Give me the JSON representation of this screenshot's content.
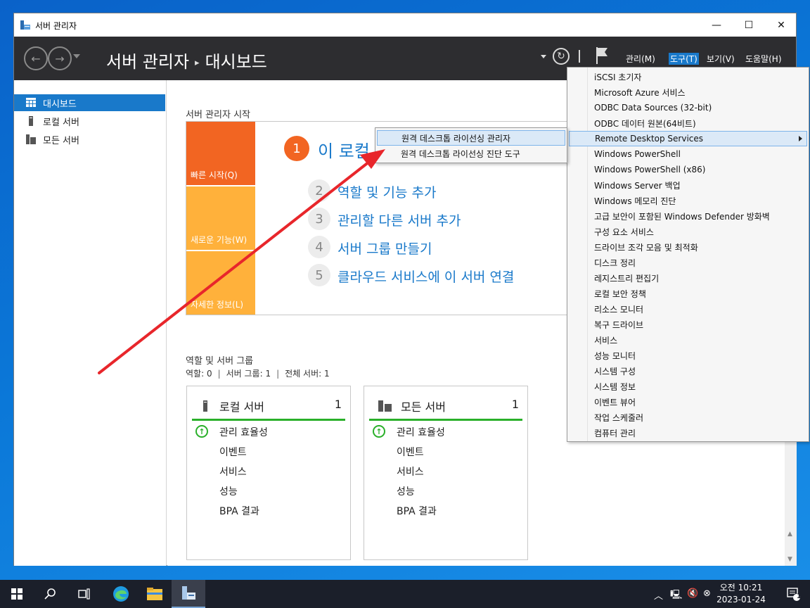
{
  "window": {
    "title": "서버 관리자",
    "minimize": "—",
    "maximize": "☐",
    "close": "✕"
  },
  "header": {
    "app_name": "서버 관리자",
    "separator": "▸",
    "page": "대시보드",
    "menus": [
      "관리(M)",
      "도구(T)",
      "보기(V)",
      "도움말(H)"
    ],
    "active_menu_index": 1
  },
  "sidebar": {
    "items": [
      {
        "label": "대시보드",
        "icon": "dashboard-icon",
        "selected": true
      },
      {
        "label": "로컬 서버",
        "icon": "server-icon",
        "selected": false
      },
      {
        "label": "모든 서버",
        "icon": "servers-icon",
        "selected": false
      }
    ]
  },
  "welcome": {
    "section_title": "서버 관리자 시작",
    "tiles": [
      "빠른 시작(Q)",
      "새로운 기능(W)",
      "자세한 정보(L)"
    ],
    "tile_colors": [
      "#f26522",
      "#ffb13b",
      "#ffb13b"
    ],
    "step1_number": "1",
    "step1_text": "이 로컬",
    "steps": [
      {
        "num": "2",
        "text": "역할 및 기능 추가"
      },
      {
        "num": "3",
        "text": "관리할 다른 서버 추가"
      },
      {
        "num": "4",
        "text": "서버 그룹 만들기"
      },
      {
        "num": "5",
        "text": "클라우드 서비스에 이 서버 연결"
      }
    ]
  },
  "roles": {
    "section_title": "역할 및 서버 그룹",
    "counts": [
      "역할: 0",
      "서버 그룹: 1",
      "전체 서버: 1"
    ],
    "separator": "|",
    "cards": [
      {
        "title": "로컬 서버",
        "count": "1",
        "rows": [
          "관리 효율성",
          "이벤트",
          "서비스",
          "성능",
          "BPA 결과"
        ]
      },
      {
        "title": "모든 서버",
        "count": "1",
        "rows": [
          "관리 효율성",
          "이벤트",
          "서비스",
          "성능",
          "BPA 결과"
        ]
      }
    ]
  },
  "tools_menu": {
    "items": [
      "iSCSI 초기자",
      "Microsoft Azure 서비스",
      "ODBC Data Sources (32-bit)",
      "ODBC 데이터 원본(64비트)",
      "Remote Desktop Services",
      "Windows PowerShell",
      "Windows PowerShell (x86)",
      "Windows Server 백업",
      "Windows 메모리 진단",
      "고급 보안이 포함된 Windows Defender 방화벽",
      "구성 요소 서비스",
      "드라이브 조각 모음 및 최적화",
      "디스크 정리",
      "레지스트리 편집기",
      "로컬 보안 정책",
      "리소스 모니터",
      "복구 드라이브",
      "서비스",
      "성능 모니터",
      "시스템 구성",
      "시스템 정보",
      "이벤트 뷰어",
      "작업 스케줄러",
      "컴퓨터 관리"
    ],
    "hover_index": 4
  },
  "submenu": {
    "items": [
      "원격 데스크톱 라이선싱 관리자",
      "원격 데스크톱 라이선싱 진단 도구"
    ],
    "hover_index": 0
  },
  "taskbar": {
    "clock_time": "오전 10:21",
    "clock_date": "2023-01-24",
    "notification_count": "1"
  },
  "colors": {
    "accent": "#1979ca",
    "header_bg": "#2d2d30",
    "ok_green": "#2ab02a",
    "step1": "#f26522"
  }
}
